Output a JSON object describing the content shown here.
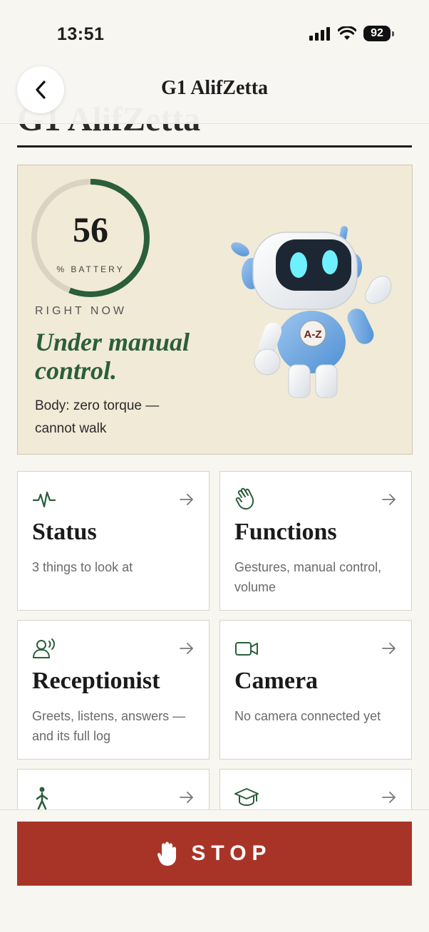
{
  "status_bar": {
    "time": "13:51",
    "battery": "92"
  },
  "nav": {
    "title": "G1 AlifZetta",
    "ghost_title": "G1 AlifZetta"
  },
  "hero": {
    "battery_value": 56,
    "battery_value_text": "56",
    "battery_label": "% BATTERY",
    "now_label": "RIGHT NOW",
    "state_title": "Under manual control.",
    "state_subtitle": "Body: zero torque — cannot walk",
    "robot_badge": "A-Z"
  },
  "tiles": [
    {
      "title": "Status",
      "desc": "3 things to look at",
      "icon": "pulse-icon"
    },
    {
      "title": "Functions",
      "desc": "Gestures, manual control, volume",
      "icon": "hand-wave-icon"
    },
    {
      "title": "Receptionist",
      "desc": "Greets, listens, answers — and its full log",
      "icon": "speaking-person-icon"
    },
    {
      "title": "Camera",
      "desc": "No camera connected yet",
      "icon": "video-camera-icon"
    },
    {
      "title": "",
      "desc": "",
      "icon": "walking-person-icon"
    },
    {
      "title": "",
      "desc": "",
      "icon": "graduation-cap-icon"
    }
  ],
  "stop": {
    "label": "STOP",
    "icon": "hand-stop-icon"
  },
  "colors": {
    "accent_green": "#2b5e3b",
    "stop_red": "#a83427",
    "hero_bg": "#f1ead7"
  }
}
